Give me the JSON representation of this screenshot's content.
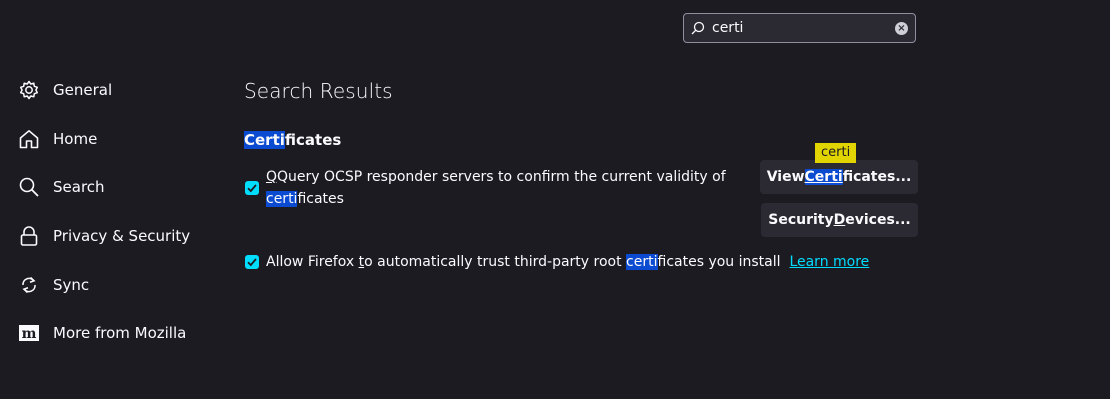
{
  "search": {
    "value": "certi"
  },
  "sidebar": {
    "items": [
      {
        "label": "General",
        "icon": "gear-icon"
      },
      {
        "label": "Home",
        "icon": "home-icon"
      },
      {
        "label": "Search",
        "icon": "search-icon"
      },
      {
        "label": "Privacy & Security",
        "icon": "lock-icon"
      },
      {
        "label": "Sync",
        "icon": "sync-icon"
      },
      {
        "label": "More from Mozilla",
        "icon": "mozilla-logo-icon"
      }
    ]
  },
  "main": {
    "results_title": "Search Results",
    "section": {
      "title_hl": "Certi",
      "title_rest": "ficates"
    },
    "option1": {
      "line1": "Query OCSP responder servers to confirm the current validity of",
      "line2_hl": "certi",
      "line2_rest": "ficates",
      "checked": true
    },
    "option2": {
      "prefix": "Allow Firefox ",
      "accesskey": "t",
      "middle": "o automatically trust third-party root ",
      "hl": "certi",
      "suffix": "ficates you install",
      "link": "Learn more",
      "checked": true
    },
    "buttons": {
      "view_pre": "View ",
      "view_hl": "Certi",
      "view_post": "ficates...",
      "devices_pre": "Security ",
      "devices_key": "D",
      "devices_post": "evices..."
    },
    "tooltip": "certi"
  },
  "colors": {
    "background": "#1c1b22",
    "accent": "#00ddff",
    "highlight": "#0a4bd1",
    "tooltip": "#e2d400"
  }
}
